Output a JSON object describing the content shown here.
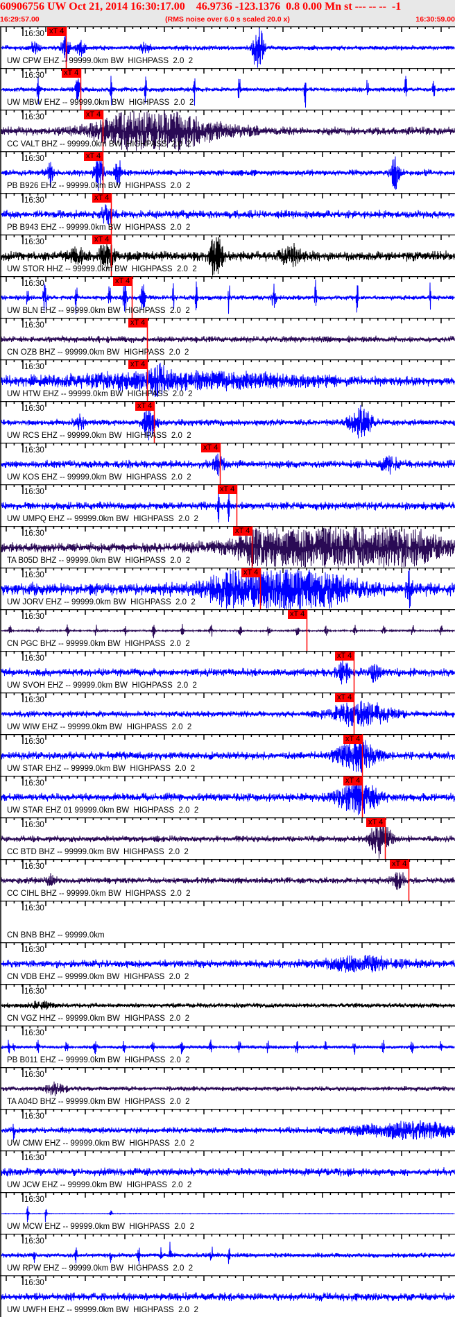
{
  "header": {
    "title": "60906756 UW Oct 21, 2014 16:30:17.00    46.9736 -123.1376  0.8 0.00 Mn st --- -- --  -1",
    "start_time": "16:29:57.00",
    "note": "(RMS noise over 6.0 s scaled 20.0 x)",
    "end_time": "16:30:59.00"
  },
  "time_tick_label": "16:30",
  "window_seconds": 62,
  "colors": {
    "header_text": "#ff0000",
    "pick": "#ff0000",
    "blue": "#0000ff",
    "purple": "#2a0a55",
    "black": "#000000"
  },
  "traces": [
    {
      "label": "UW CPW EHZ -- 99999.0km BW  HIGHPASS  2.0  2",
      "color": "blue",
      "pick": {
        "label": "xT 4",
        "t": 9.0
      }
    },
    {
      "label": "UW MBW EHZ -- 99999.0km BW  HIGHPASS  2.0  2",
      "color": "blue",
      "pick": {
        "label": "xT 4",
        "t": 11.0
      }
    },
    {
      "label": "CC VALT BHZ -- 99999.0km BW  HIGHPASS  2.0  2",
      "color": "purple",
      "pick": {
        "label": "xT 4",
        "t": 14.0
      }
    },
    {
      "label": "PB B926 EHZ -- 99999.0km BW  HIGHPASS  2.0  2",
      "color": "blue",
      "pick": {
        "label": "xT 4",
        "t": 14.0
      }
    },
    {
      "label": "PB B943 EHZ -- 99999.0km BW  HIGHPASS  2.0  2",
      "color": "blue",
      "pick": {
        "label": "xT 4",
        "t": 15.1
      }
    },
    {
      "label": "UW STOR HHZ -- 99999.0km BW  HIGHPASS  2.0  2",
      "color": "black",
      "pick": {
        "label": "xT 4",
        "t": 15.1
      }
    },
    {
      "label": "UW BLN EHZ -- 99999.0km BW  HIGHPASS  2.0  2",
      "color": "blue",
      "pick": {
        "label": "xT 4",
        "t": 18.0
      }
    },
    {
      "label": "CN OZB BHZ -- 99999.0km BW  HIGHPASS  2.0  2",
      "color": "purple",
      "pick": {
        "label": "xT 4",
        "t": 20.0
      }
    },
    {
      "label": "UW HTW EHZ -- 99999.0km BW  HIGHPASS  2.0  2",
      "color": "blue",
      "pick": {
        "label": "xT 4",
        "t": 20.0
      }
    },
    {
      "label": "UW RCS EHZ -- 99999.0km BW  HIGHPASS  2.0  2",
      "color": "blue",
      "pick": {
        "label": "xT 4",
        "t": 21.0
      }
    },
    {
      "label": "UW KOS EHZ -- 99999.0km BW  HIGHPASS  2.0  2",
      "color": "blue",
      "pick": {
        "label": "xT 4",
        "t": 30.0
      }
    },
    {
      "label": "UW UMPQ EHZ -- 99999.0km BW  HIGHPASS  2.0  2",
      "color": "blue",
      "pick": {
        "label": "xT 4",
        "t": 32.2
      }
    },
    {
      "label": "TA B05D BHZ -- 99999.0km BW  HIGHPASS  2.0  2",
      "color": "purple",
      "pick": {
        "label": "xT 4",
        "t": 34.3
      }
    },
    {
      "label": "UW JORV EHZ -- 99999.0km BW  HIGHPASS  2.0  2",
      "color": "blue",
      "pick": {
        "label": "xT 4",
        "t": 35.4
      }
    },
    {
      "label": "CN PGC BHZ -- 99999.0km BW  HIGHPASS  2.0  2",
      "color": "purple",
      "pick": {
        "label": "xT 4",
        "t": 41.8
      }
    },
    {
      "label": "UW SVOH EHZ -- 99999.0km BW  HIGHPASS  2.0  2",
      "color": "blue",
      "pick": {
        "label": "xT 4",
        "t": 48.2
      }
    },
    {
      "label": "UW WIW EHZ -- 99999.0km BW  HIGHPASS  2.0  2",
      "color": "blue",
      "pick": {
        "label": "xT 4",
        "t": 48.2
      }
    },
    {
      "label": "UW STAR EHZ -- 99999.0km BW  HIGHPASS  2.0  2",
      "color": "blue",
      "pick": {
        "label": "xT 4",
        "t": 49.3
      }
    },
    {
      "label": "UW STAR EHZ 01 99999.0km BW  HIGHPASS  2.0  2",
      "color": "blue",
      "pick": {
        "label": "xT 4",
        "t": 49.3
      }
    },
    {
      "label": "CC BTD BHZ -- 99999.0km BW  HIGHPASS  2.0  2",
      "color": "purple",
      "pick": {
        "label": "xT 4",
        "t": 52.5
      }
    },
    {
      "label": "CC CIHL BHZ -- 99999.0km BW  HIGHPASS  2.0  2",
      "color": "purple",
      "pick": {
        "label": "xT 4",
        "t": 55.7
      }
    },
    {
      "label": "CN BNB BHZ -- 99999.0km",
      "color": "blue",
      "pick": null
    },
    {
      "label": "CN VDB EHZ -- 99999.0km BW  HIGHPASS  2.0  2",
      "color": "blue",
      "pick": null
    },
    {
      "label": "CN VGZ HHZ -- 99999.0km BW  HIGHPASS  2.0  2",
      "color": "black",
      "pick": null
    },
    {
      "label": "PB B011 EHZ -- 99999.0km BW  HIGHPASS  2.0  2",
      "color": "blue",
      "pick": null
    },
    {
      "label": "TA A04D BHZ -- 99999.0km BW  HIGHPASS  2.0  2",
      "color": "purple",
      "pick": null
    },
    {
      "label": "UW CMW EHZ -- 99999.0km BW  HIGHPASS  2.0  2",
      "color": "blue",
      "pick": null
    },
    {
      "label": "UW JCW EHZ -- 99999.0km BW  HIGHPASS  2.0  2",
      "color": "blue",
      "pick": null
    },
    {
      "label": "UW MCW EHZ -- 99999.0km BW  HIGHPASS  2.0  2",
      "color": "blue",
      "pick": null
    },
    {
      "label": "UW RPW EHZ -- 99999.0km BW  HIGHPASS  2.0  2",
      "color": "blue",
      "pick": null
    },
    {
      "label": "UW UWFH EHZ -- 99999.0km BW  HIGHPASS  2.0  2",
      "color": "blue",
      "pick": null
    }
  ]
}
